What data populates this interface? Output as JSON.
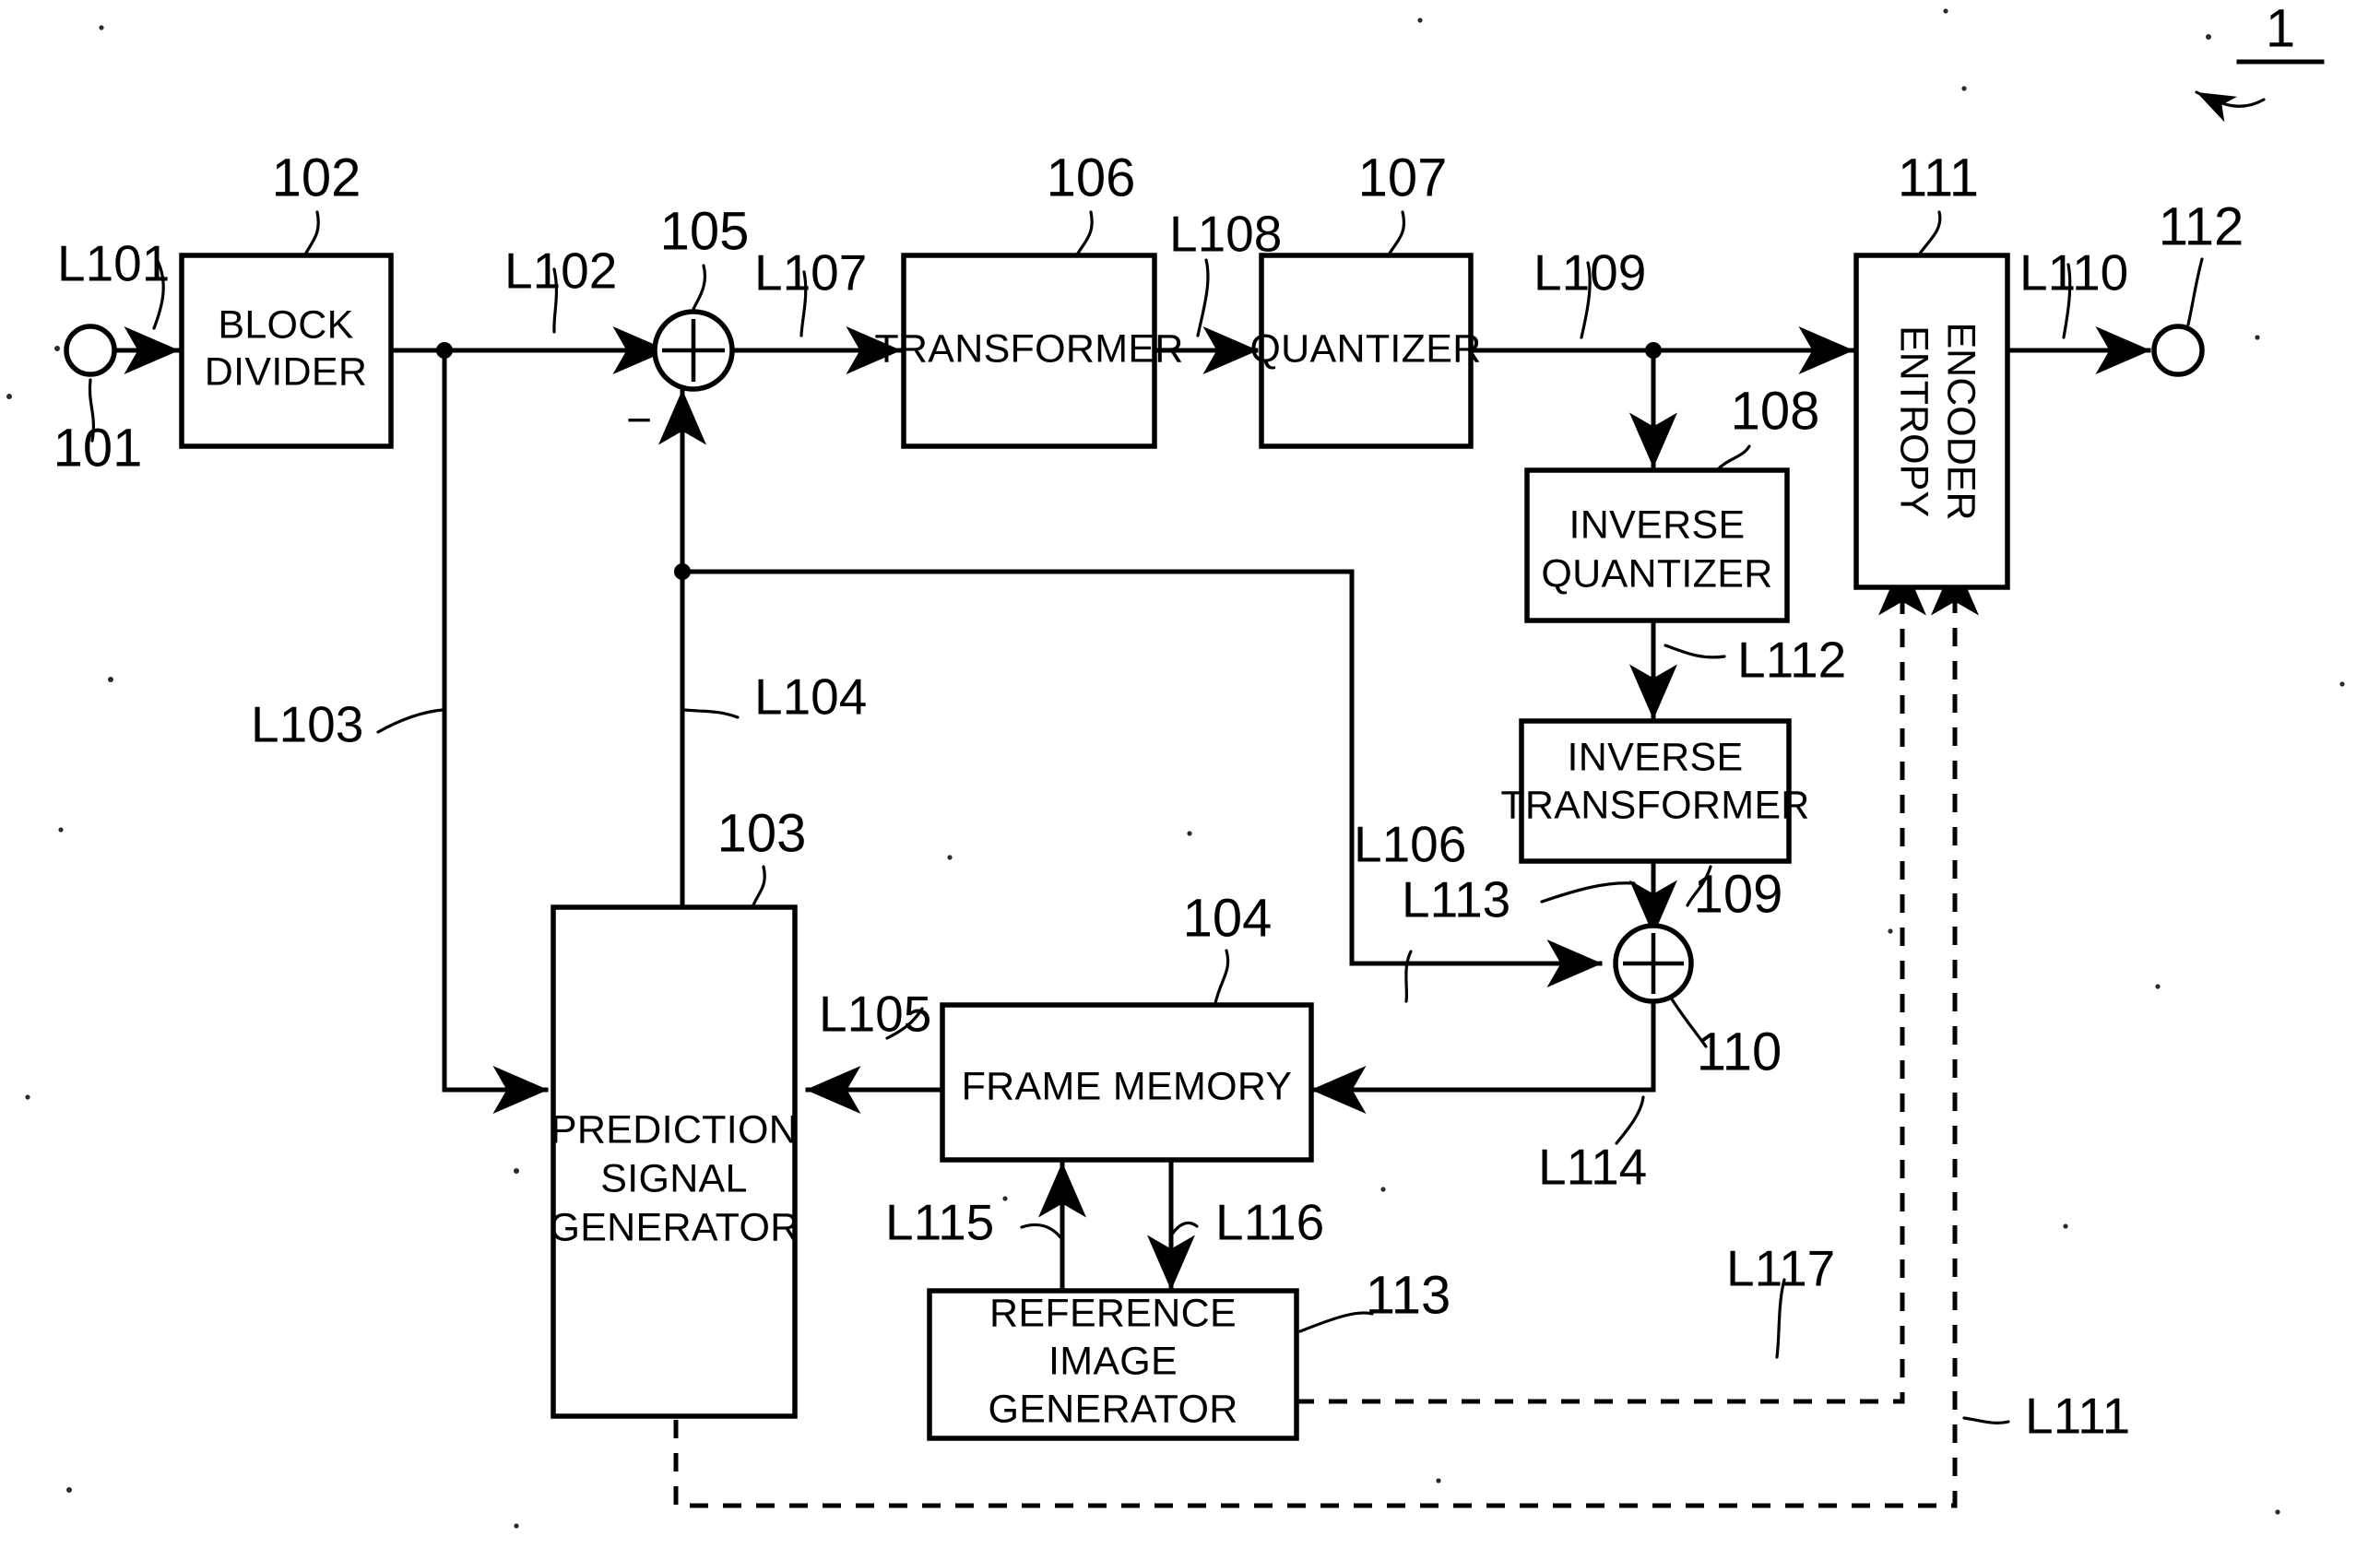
{
  "figure": {
    "system_ref": "1",
    "blocks": [
      {
        "id": "block_divider",
        "ref": "102",
        "label": "BLOCK\nDIVIDER",
        "lines": [
          "BLOCK",
          "DIVIDER"
        ]
      },
      {
        "id": "transformer",
        "ref": "106",
        "label": "TRANSFORMER",
        "lines": [
          "TRANSFORMER"
        ]
      },
      {
        "id": "quantizer",
        "ref": "107",
        "label": "QUANTIZER",
        "lines": [
          "QUANTIZER"
        ]
      },
      {
        "id": "entropy_encoder",
        "ref": "111",
        "label": "ENTROPY ENCODER",
        "lines": [
          "ENTROPY",
          "ENCODER"
        ]
      },
      {
        "id": "inverse_quantizer",
        "ref": "108",
        "label": "INVERSE QUANTIZER",
        "lines": [
          "INVERSE",
          "QUANTIZER"
        ]
      },
      {
        "id": "inverse_transformer",
        "ref": "109",
        "label": "INVERSE TRANSFORMER",
        "lines": [
          "INVERSE",
          "TRANSFORMER"
        ]
      },
      {
        "id": "prediction_signal_generator",
        "ref": "103",
        "label": "PREDICTION SIGNAL GENERATOR",
        "lines": [
          "PREDICTION",
          "SIGNAL",
          "GENERATOR"
        ]
      },
      {
        "id": "frame_memory",
        "ref": "104",
        "label": "FRAME MEMORY",
        "lines": [
          "FRAME MEMORY"
        ]
      },
      {
        "id": "reference_image_generator",
        "ref": "113",
        "label": "REFERENCE IMAGE GENERATOR",
        "lines": [
          "REFERENCE",
          "IMAGE",
          "GENERATOR"
        ]
      }
    ],
    "terminals": [
      {
        "id": "input_terminal",
        "ref": "101",
        "role": "input"
      },
      {
        "id": "output_terminal",
        "ref": "112",
        "role": "output"
      }
    ],
    "operators": [
      {
        "id": "subtractor",
        "ref": "105",
        "symbol": "+",
        "secondary_sign": "−"
      },
      {
        "id": "adder",
        "ref": "110",
        "symbol": "+",
        "secondary_sign": ""
      }
    ],
    "signals": [
      {
        "id": "L101",
        "label": "L101"
      },
      {
        "id": "L102",
        "label": "L102"
      },
      {
        "id": "L103",
        "label": "L103"
      },
      {
        "id": "L104",
        "label": "L104"
      },
      {
        "id": "L105",
        "label": "L105"
      },
      {
        "id": "L106",
        "label": "L106"
      },
      {
        "id": "L107",
        "label": "L107"
      },
      {
        "id": "L108",
        "label": "L108"
      },
      {
        "id": "L109",
        "label": "L109"
      },
      {
        "id": "L110",
        "label": "L110"
      },
      {
        "id": "L111",
        "label": "L111"
      },
      {
        "id": "L112",
        "label": "L112"
      },
      {
        "id": "L113",
        "label": "L113"
      },
      {
        "id": "L114",
        "label": "L114"
      },
      {
        "id": "L115",
        "label": "L115"
      },
      {
        "id": "L116",
        "label": "L116"
      },
      {
        "id": "L117",
        "label": "L117"
      }
    ],
    "ref_numbers": {
      "block_divider": "102",
      "prediction_signal_generator": "103",
      "frame_memory": "104",
      "subtractor": "105",
      "transformer": "106",
      "quantizer": "107",
      "inverse_quantizer": "108",
      "inverse_transformer": "109",
      "adder": "110",
      "entropy_encoder": "111",
      "output_terminal": "112",
      "reference_image_generator": "113",
      "input_terminal": "101",
      "system": "1"
    },
    "colors": {
      "ink": "#000000",
      "paper": "#ffffff"
    }
  }
}
